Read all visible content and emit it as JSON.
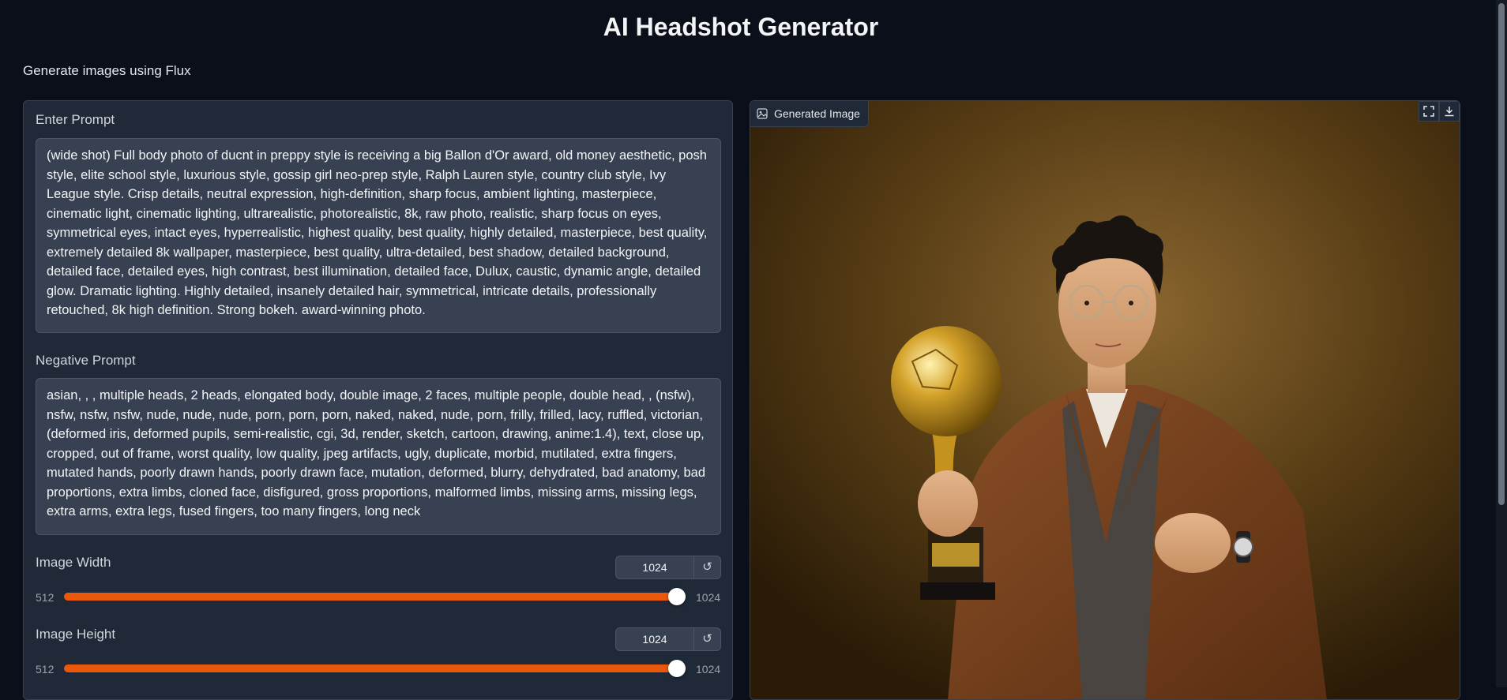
{
  "header": {
    "title": "AI Headshot Generator",
    "description": "Generate images using Flux"
  },
  "prompt": {
    "label": "Enter Prompt",
    "value": "(wide shot)  Full body photo of ducnt in preppy style is receiving a big Ballon d'Or award, old money aesthetic, posh style, elite school style, luxurious style, gossip girl neo-prep style, Ralph Lauren style, country club style, Ivy League style. Crisp details, neutral expression, high-definition, sharp focus, ambient lighting, masterpiece, cinematic light, cinematic lighting, ultrarealistic, photorealistic, 8k, raw photo, realistic, sharp focus on eyes, symmetrical eyes, intact eyes, hyperrealistic, highest quality, best quality, highly detailed, masterpiece, best quality, extremely detailed 8k wallpaper, masterpiece, best quality, ultra-detailed, best shadow, detailed background, detailed face, detailed eyes, high contrast, best illumination, detailed face, Dulux, caustic, dynamic angle, detailed glow. Dramatic lighting. Highly detailed, insanely detailed hair, symmetrical, intricate details, professionally retouched, 8k high definition. Strong bokeh. award-winning photo."
  },
  "negative_prompt": {
    "label": "Negative Prompt",
    "value": "asian, , , multiple heads, 2 heads, elongated body, double image, 2 faces, multiple people, double head, , (nsfw), nsfw, nsfw, nsfw, nude, nude, nude, porn, porn, porn, naked, naked, nude, porn, frilly, frilled, lacy, ruffled, victorian, (deformed iris, deformed pupils, semi-realistic, cgi, 3d, render, sketch, cartoon, drawing, anime:1.4), text, close up, cropped, out of frame, worst quality, low quality, jpeg artifacts, ugly, duplicate, morbid, mutilated, extra fingers, mutated hands, poorly drawn hands, poorly drawn face, mutation, deformed, blurry, dehydrated, bad anatomy, bad proportions, extra limbs, cloned face, disfigured, gross proportions, malformed limbs, missing arms, missing legs, extra arms, extra legs, fused fingers, too many fingers, long neck"
  },
  "width_slider": {
    "label": "Image Width",
    "value": "1024",
    "min": "512",
    "max": "1024",
    "level": 1.0
  },
  "height_slider": {
    "label": "Image Height",
    "value": "1024",
    "min": "512",
    "max": "1024",
    "level": 1.0
  },
  "output": {
    "label": "Generated Image"
  },
  "colors": {
    "accent": "#ea580c",
    "background": "#0b0f19",
    "panel": "#1f2937"
  },
  "icons": {
    "reset": "reset-icon",
    "image": "image-icon",
    "fullscreen": "fullscreen-icon",
    "download": "download-icon"
  }
}
